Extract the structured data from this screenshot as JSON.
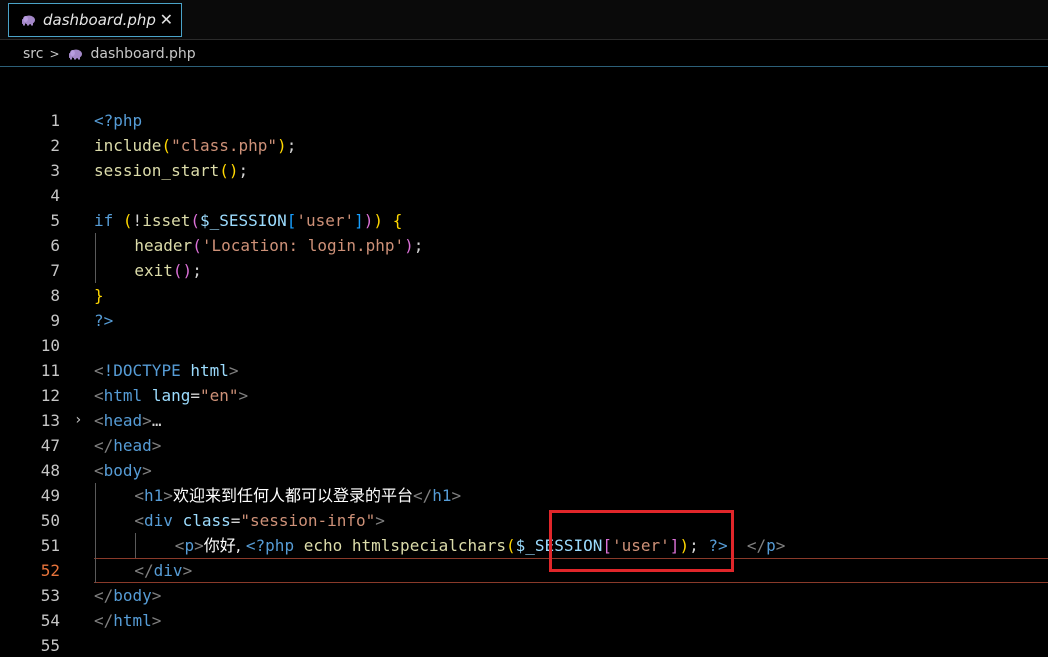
{
  "tab": {
    "label": "dashboard.php",
    "close": "✕",
    "icon": "php-elephant-icon",
    "accent": "#4aa3c8"
  },
  "breadcrumb": {
    "folder": "src",
    "file": "dashboard.php"
  },
  "lines": [
    {
      "n": "1",
      "segs": [
        [
          "kw",
          "<?php"
        ]
      ]
    },
    {
      "n": "2",
      "segs": [
        [
          "fn",
          "include"
        ],
        [
          "br1",
          "("
        ],
        [
          "str",
          "\"class.php\""
        ],
        [
          "br1",
          ")"
        ],
        [
          "pl",
          ";"
        ]
      ]
    },
    {
      "n": "3",
      "segs": [
        [
          "fn",
          "session_start"
        ],
        [
          "br1",
          "()"
        ],
        [
          "pl",
          ";"
        ]
      ]
    },
    {
      "n": "4",
      "segs": []
    },
    {
      "n": "5",
      "segs": [
        [
          "kw",
          "if"
        ],
        [
          "pl",
          " "
        ],
        [
          "br1",
          "("
        ],
        [
          "pl",
          "!"
        ],
        [
          "fn",
          "isset"
        ],
        [
          "br2",
          "("
        ],
        [
          "var",
          "$_SESSION"
        ],
        [
          "br3",
          "["
        ],
        [
          "str",
          "'user'"
        ],
        [
          "br3",
          "]"
        ],
        [
          "br2",
          ")"
        ],
        [
          "br1",
          ")"
        ],
        [
          "pl",
          " "
        ],
        [
          "br1",
          "{"
        ]
      ]
    },
    {
      "n": "6",
      "indent": 1,
      "segs": [
        [
          "fn",
          "header"
        ],
        [
          "br2",
          "("
        ],
        [
          "str",
          "'Location: login.php'"
        ],
        [
          "br2",
          ")"
        ],
        [
          "pl",
          ";"
        ]
      ]
    },
    {
      "n": "7",
      "indent": 1,
      "segs": [
        [
          "fn",
          "exit"
        ],
        [
          "br2",
          "()"
        ],
        [
          "pl",
          ";"
        ]
      ]
    },
    {
      "n": "8",
      "segs": [
        [
          "br1",
          "}"
        ]
      ]
    },
    {
      "n": "9",
      "segs": [
        [
          "kw",
          "?>"
        ]
      ]
    },
    {
      "n": "10",
      "segs": []
    },
    {
      "n": "11",
      "segs": [
        [
          "tagb",
          "<"
        ],
        [
          "tag",
          "!DOCTYPE"
        ],
        [
          "pl",
          " "
        ],
        [
          "attr",
          "html"
        ],
        [
          "tagb",
          ">"
        ]
      ]
    },
    {
      "n": "12",
      "segs": [
        [
          "tagb",
          "<"
        ],
        [
          "tag",
          "html"
        ],
        [
          "pl",
          " "
        ],
        [
          "attr",
          "lang"
        ],
        [
          "pl",
          "="
        ],
        [
          "str",
          "\"en\""
        ],
        [
          "tagb",
          ">"
        ]
      ]
    },
    {
      "n": "13",
      "fold": "›",
      "segs": [
        [
          "tagb",
          "<"
        ],
        [
          "tag",
          "head"
        ],
        [
          "tagb",
          ">"
        ],
        [
          "pl",
          "…"
        ]
      ]
    },
    {
      "n": "47",
      "segs": [
        [
          "tagb",
          "</"
        ],
        [
          "tag",
          "head"
        ],
        [
          "tagb",
          ">"
        ]
      ]
    },
    {
      "n": "48",
      "segs": [
        [
          "tagb",
          "<"
        ],
        [
          "tag",
          "body"
        ],
        [
          "tagb",
          ">"
        ]
      ]
    },
    {
      "n": "49",
      "indent": 1,
      "segs": [
        [
          "tagb",
          "<"
        ],
        [
          "tag",
          "h1"
        ],
        [
          "tagb",
          ">"
        ],
        [
          "txt",
          "欢迎来到任何人都可以登录的平台"
        ],
        [
          "tagb",
          "</"
        ],
        [
          "tag",
          "h1"
        ],
        [
          "tagb",
          ">"
        ]
      ]
    },
    {
      "n": "50",
      "indent": 1,
      "segs": [
        [
          "tagb",
          "<"
        ],
        [
          "tag",
          "div"
        ],
        [
          "pl",
          " "
        ],
        [
          "attr",
          "class"
        ],
        [
          "pl",
          "="
        ],
        [
          "str",
          "\"session-info\""
        ],
        [
          "tagb",
          ">"
        ]
      ]
    },
    {
      "n": "51",
      "indent": 2,
      "segs": [
        [
          "tagb",
          "<"
        ],
        [
          "tag",
          "p"
        ],
        [
          "tagb",
          ">"
        ],
        [
          "txt",
          "你好, "
        ],
        [
          "kw",
          "<?php"
        ],
        [
          "pl",
          " "
        ],
        [
          "fn",
          "echo"
        ],
        [
          "pl",
          " "
        ],
        [
          "fn",
          "htmlspecialchars"
        ],
        [
          "br1",
          "("
        ],
        [
          "var",
          "$_SESSION"
        ],
        [
          "br2",
          "["
        ],
        [
          "str",
          "'user'"
        ],
        [
          "br2",
          "]"
        ],
        [
          "br1",
          ")"
        ],
        [
          "pl",
          "; "
        ],
        [
          "kw",
          "?>"
        ],
        [
          "pl",
          "! "
        ],
        [
          "tagb",
          "</"
        ],
        [
          "tag",
          "p"
        ],
        [
          "tagb",
          ">"
        ]
      ]
    },
    {
      "n": "52",
      "indent": 1,
      "active": true,
      "segs": [
        [
          "tagb",
          "</"
        ],
        [
          "tag",
          "div"
        ],
        [
          "tagb",
          ">"
        ]
      ]
    },
    {
      "n": "53",
      "segs": [
        [
          "tagb",
          "</"
        ],
        [
          "tag",
          "body"
        ],
        [
          "tagb",
          ">"
        ]
      ]
    },
    {
      "n": "54",
      "segs": [
        [
          "tagb",
          "</"
        ],
        [
          "tag",
          "html"
        ],
        [
          "tagb",
          ">"
        ]
      ]
    },
    {
      "n": "55",
      "segs": []
    }
  ],
  "colors": {
    "highlight_box": "#e0262a",
    "active_line_number": "#e8743b"
  }
}
